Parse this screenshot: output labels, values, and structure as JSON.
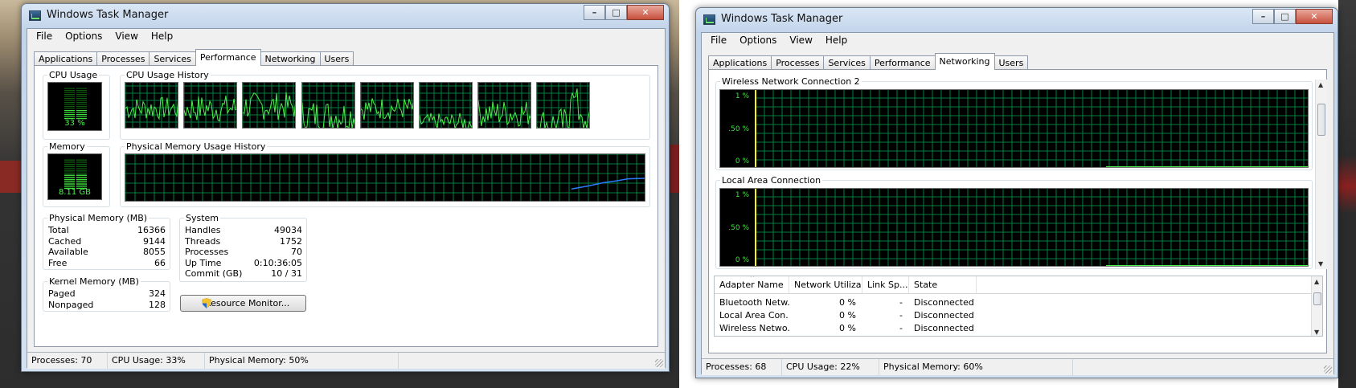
{
  "window1": {
    "title": "Windows Task Manager",
    "menu": [
      "File",
      "Options",
      "View",
      "Help"
    ],
    "tabs": [
      "Applications",
      "Processes",
      "Services",
      "Performance",
      "Networking",
      "Users"
    ],
    "active_tab": "Performance",
    "cpu_usage": {
      "label": "CPU Usage",
      "value_text": "33 %",
      "fraction": 0.33
    },
    "cpu_history": {
      "label": "CPU Usage History",
      "cores": 8
    },
    "memory": {
      "label": "Memory",
      "value_text": "8.11 GB",
      "fraction": 0.5
    },
    "phys_history": {
      "label": "Physical Memory Usage History"
    },
    "physical_memory": {
      "label": "Physical Memory (MB)",
      "rows": [
        {
          "k": "Total",
          "v": "16366"
        },
        {
          "k": "Cached",
          "v": "9144"
        },
        {
          "k": "Available",
          "v": "8055"
        },
        {
          "k": "Free",
          "v": "66"
        }
      ]
    },
    "system": {
      "label": "System",
      "rows": [
        {
          "k": "Handles",
          "v": "49034"
        },
        {
          "k": "Threads",
          "v": "1752"
        },
        {
          "k": "Processes",
          "v": "70"
        },
        {
          "k": "Up Time",
          "v": "0:10:36:05"
        },
        {
          "k": "Commit (GB)",
          "v": "10 / 31"
        }
      ]
    },
    "kernel_memory": {
      "label": "Kernel Memory (MB)",
      "rows": [
        {
          "k": "Paged",
          "v": "324"
        },
        {
          "k": "Nonpaged",
          "v": "128"
        }
      ]
    },
    "resource_button": "Resource Monitor...",
    "status": [
      "Processes: 70",
      "CPU Usage: 33%",
      "Physical Memory: 50%"
    ]
  },
  "window2": {
    "title": "Windows Task Manager",
    "menu": [
      "File",
      "Options",
      "View",
      "Help"
    ],
    "tabs": [
      "Applications",
      "Processes",
      "Services",
      "Performance",
      "Networking",
      "Users"
    ],
    "active_tab": "Networking",
    "graphs": [
      {
        "label": "Wireless Network Connection 2",
        "y_ticks": [
          "1 %",
          ".50 %",
          "0 %"
        ]
      },
      {
        "label": "Local Area Connection",
        "y_ticks": [
          "1 %",
          ".50 %",
          "0 %"
        ]
      }
    ],
    "columns": [
      "Adapter Name",
      "Network Utiliza...",
      "Link Sp...",
      "State"
    ],
    "rows": [
      [
        "Bluetooth Netw...",
        "0 %",
        "-",
        "Disconnected"
      ],
      [
        "Local Area Con...",
        "0 %",
        "-",
        "Disconnected"
      ],
      [
        "Wireless Netwo...",
        "0 %",
        "-",
        "Disconnected"
      ]
    ],
    "status": [
      "Processes: 68",
      "CPU Usage: 22%",
      "Physical Memory: 60%"
    ]
  },
  "colors": {
    "graph_line": "#4cf04c",
    "grid": "#008040",
    "memory_line": "#2a7cff",
    "net_line": "#ffff00"
  }
}
